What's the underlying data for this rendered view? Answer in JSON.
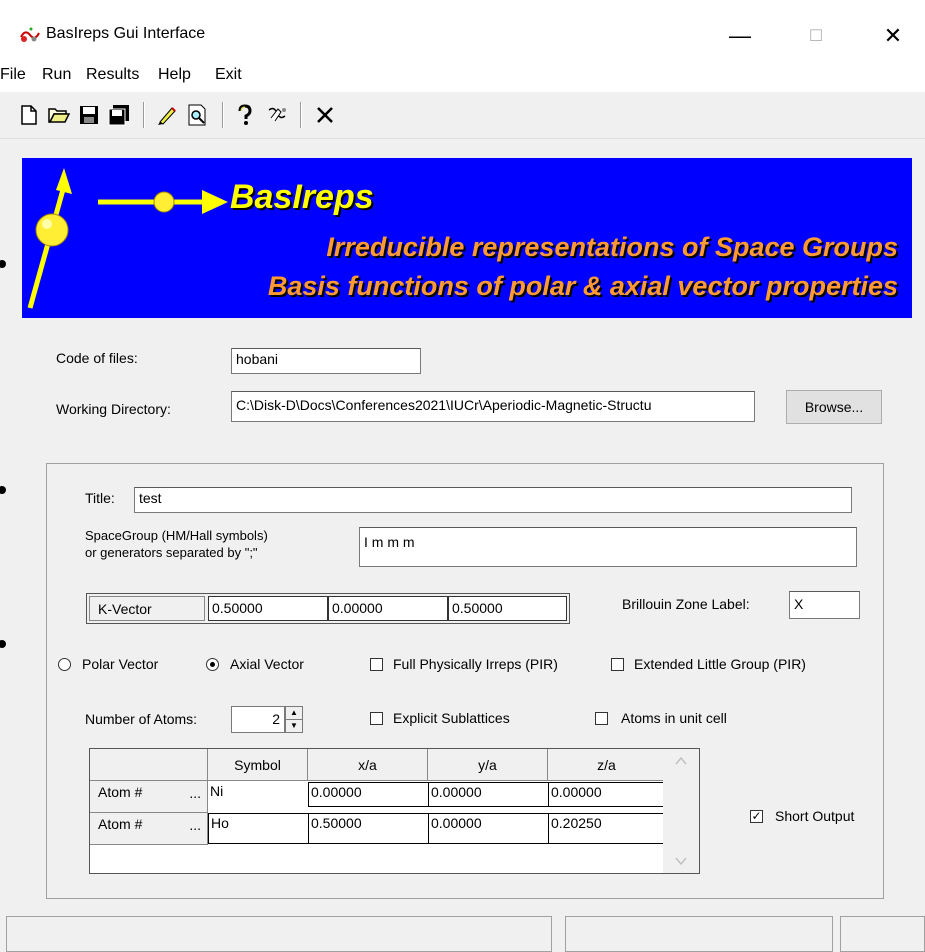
{
  "window": {
    "title": "BasIreps Gui Interface",
    "minimize": "—",
    "maximize": "☐",
    "close": "✕"
  },
  "menu": [
    "File",
    "Run",
    "Results",
    "Help",
    "Exit"
  ],
  "toolbar": {
    "icons": [
      "new-file-icon",
      "open-folder-icon",
      "save-icon",
      "save-all-icon",
      "edit-icon",
      "preview-icon",
      "help-icon",
      "about-icon",
      "close-icon"
    ]
  },
  "banner": {
    "title": "BasIreps",
    "subtitle1": "Irreducible representations of Space Groups",
    "subtitle2": "Basis functions of polar & axial vector properties",
    "colors": {
      "background": "#0000ff",
      "title": "#ffff00",
      "subtitle": "#ff9933"
    }
  },
  "files": {
    "code_label": "Code of files:",
    "code_value": "hobani",
    "dir_label": "Working Directory:",
    "dir_value": "C:\\Disk-D\\Docs\\Conferences2021\\IUCr\\Aperiodic-Magnetic-Structu",
    "browse_label": "Browse..."
  },
  "form": {
    "title_label": "Title:",
    "title_value": "test",
    "sg_label1": "SpaceGroup (HM/Hall symbols)",
    "sg_label2": "or generators separated by \";\"",
    "sg_value": "I m m m",
    "kvector_label": "K-Vector",
    "kvector": [
      "0.50000",
      "0.00000",
      "0.50000"
    ],
    "bz_label": "Brillouin Zone Label:",
    "bz_value": "X",
    "polar_label": "Polar Vector",
    "axial_label": "Axial Vector",
    "polar_selected": false,
    "axial_selected": true,
    "pir_label": "Full Physically Irreps (PIR)",
    "pir_checked": false,
    "elg_label": "Extended Little Group (PIR)",
    "elg_checked": false,
    "natoms_label": "Number of Atoms:",
    "natoms_value": "2",
    "sublat_label": "Explicit Sublattices",
    "sublat_checked": false,
    "unitcell_label": "Atoms in unit cell",
    "unitcell_checked": false,
    "short_output_label": "Short Output",
    "short_output_checked": true
  },
  "atoms_table": {
    "headers": [
      "Symbol",
      "x/a",
      "y/a",
      "z/a"
    ],
    "row_label": "Atom #",
    "row_button": "...",
    "rows": [
      {
        "symbol": "Ni",
        "x": "0.00000",
        "y": "0.00000",
        "z": "0.00000"
      },
      {
        "symbol": "Ho",
        "x": "0.50000",
        "y": "0.00000",
        "z": "0.20250"
      }
    ]
  },
  "status_bar": {
    "panels": [
      "",
      "",
      ""
    ]
  }
}
